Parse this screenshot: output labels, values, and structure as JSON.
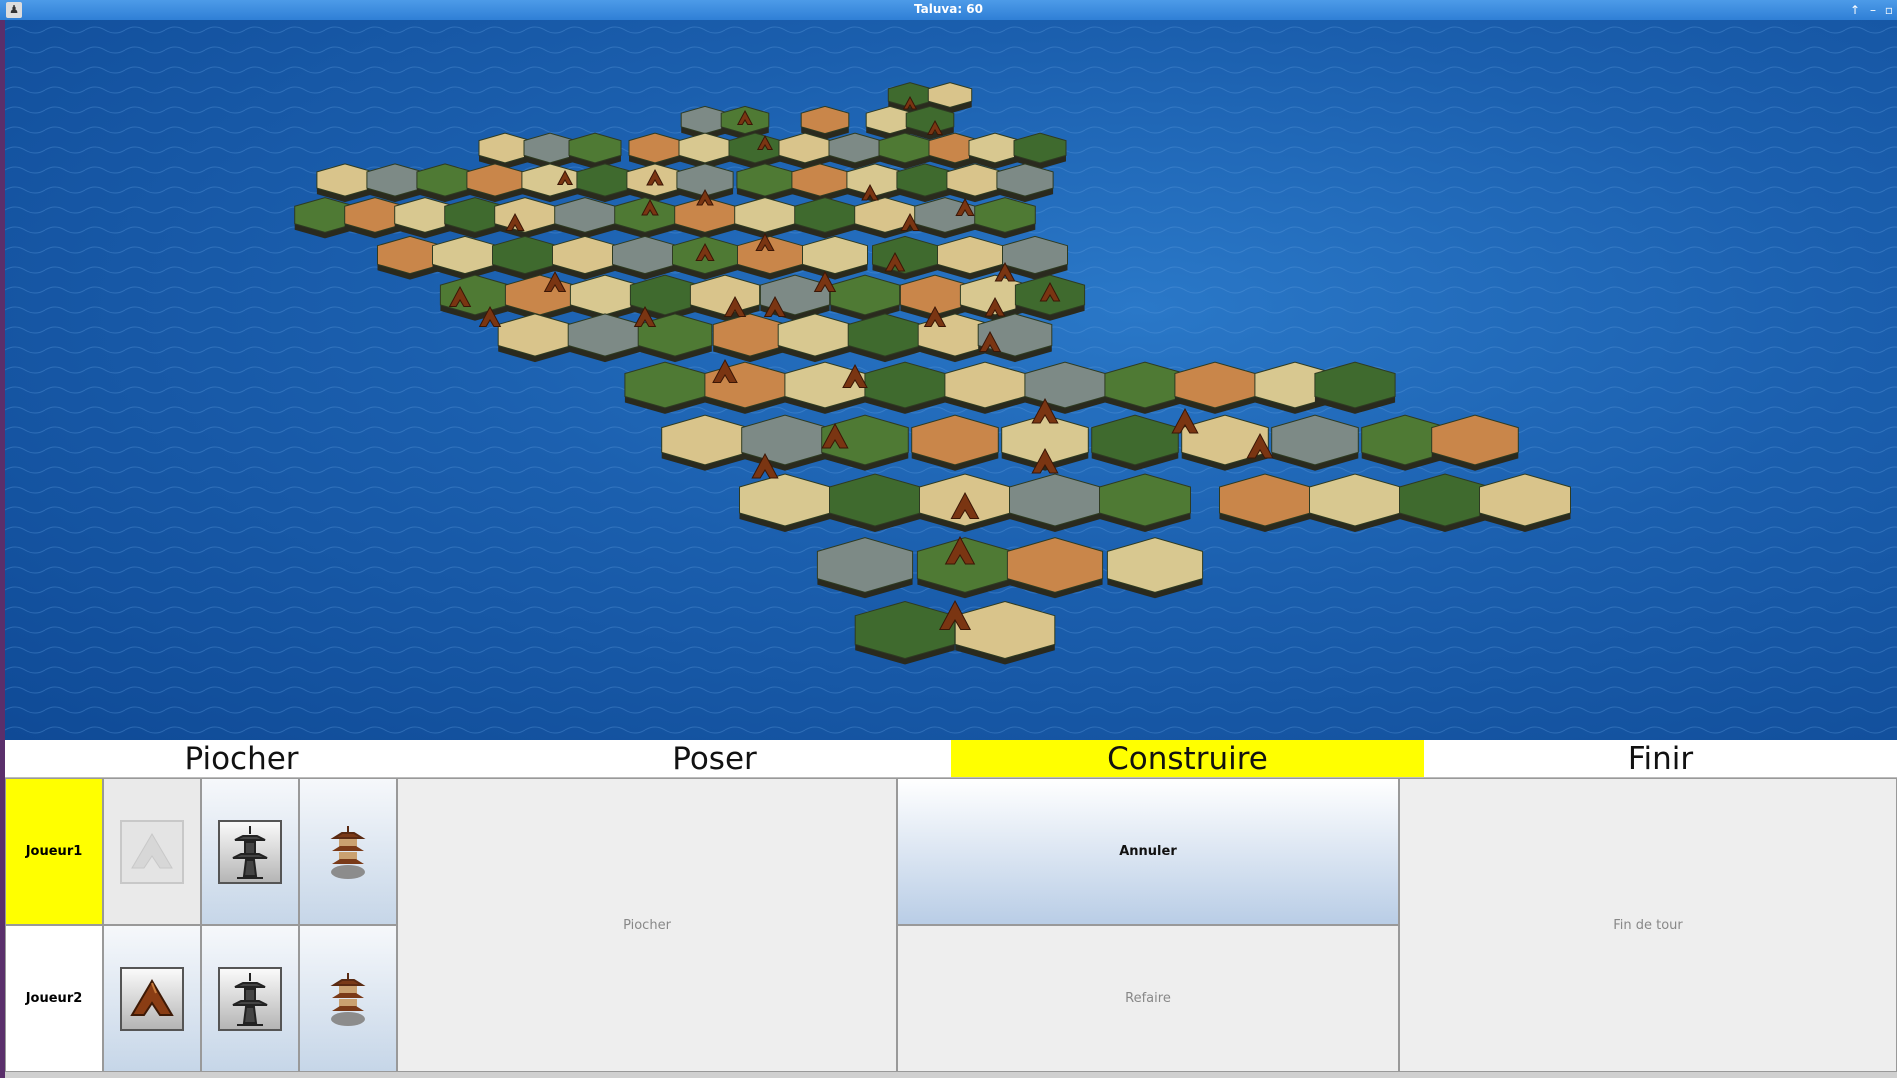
{
  "window": {
    "title": "Taluva: 60"
  },
  "phases": [
    {
      "label": "Piocher",
      "active": false
    },
    {
      "label": "Poser",
      "active": false
    },
    {
      "label": "Construire",
      "active": true
    },
    {
      "label": "Finir",
      "active": false
    }
  ],
  "players": [
    {
      "name": "Joueur1",
      "active": true
    },
    {
      "name": "Joueur2",
      "active": false
    }
  ],
  "pieces": {
    "hut": "hut-icon",
    "tower": "tower-icon",
    "temple": "temple-icon"
  },
  "actions": {
    "piocher": "Piocher",
    "annuler": "Annuler",
    "refaire": "Refaire",
    "fin_de_tour": "Fin de tour"
  },
  "colors": {
    "active_highlight": "#ffff00",
    "sea": "#1b5fae",
    "titlebar": "#2f7fd6"
  }
}
